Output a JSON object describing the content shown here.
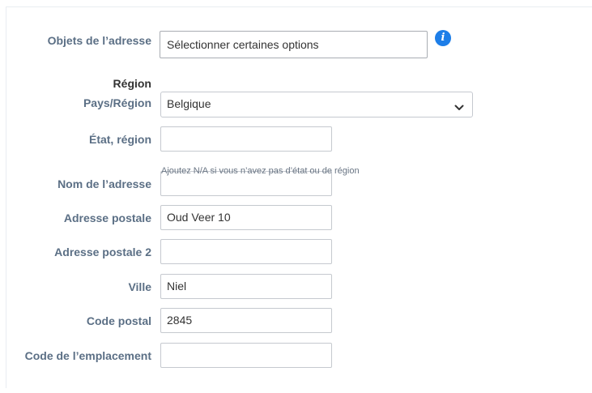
{
  "form": {
    "address_objects": {
      "label": "Objets de l’adresse",
      "placeholder": "Sélectionner certaines options"
    },
    "region_heading": "Région",
    "country": {
      "label": "Pays/Région",
      "value": "Belgique"
    },
    "state": {
      "label": "État, région",
      "value": "",
      "help": "Ajoutez N/A si vous n’avez pas d’état ou de région"
    },
    "address_name": {
      "label": "Nom de l’adresse",
      "value": ""
    },
    "street": {
      "label": "Adresse postale",
      "value": "Oud Veer 10"
    },
    "street2": {
      "label": "Adresse postale 2",
      "value": ""
    },
    "city": {
      "label": "Ville",
      "value": "Niel"
    },
    "postal_code": {
      "label": "Code postal",
      "value": "2845"
    },
    "location_code": {
      "label": "Code de l’emplacement",
      "value": ""
    }
  },
  "icons": {
    "info": "info-icon",
    "dropdown": "chevron-down-icon"
  },
  "colors": {
    "label": "#5b6f85",
    "info_icon": "#1d7ee8",
    "border": "#c5c9cf"
  }
}
